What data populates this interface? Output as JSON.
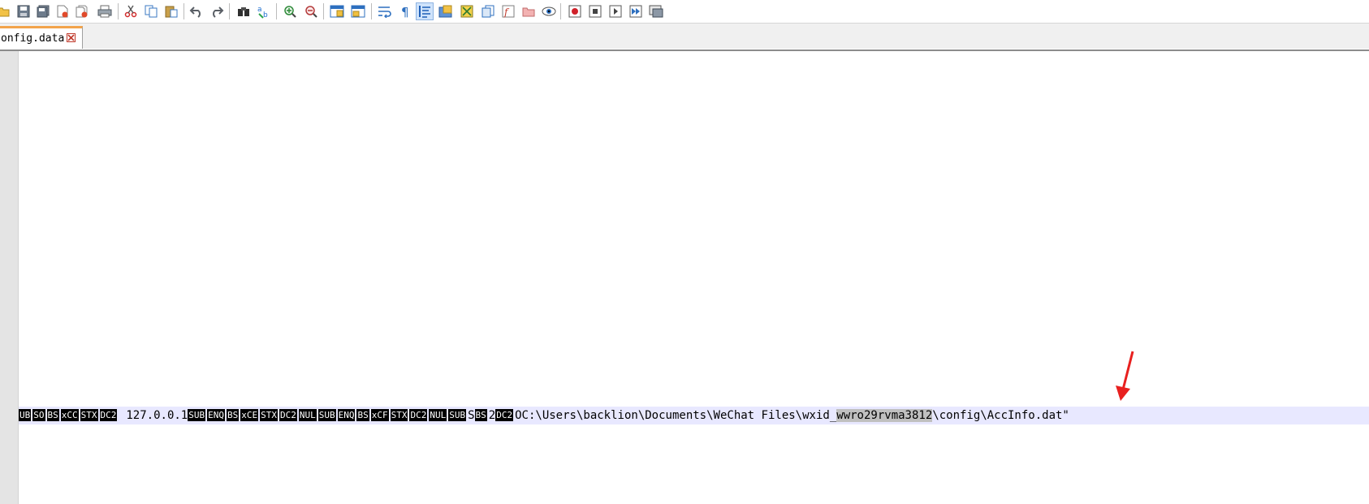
{
  "toolbar": {
    "active_button": "wrap-symbol"
  },
  "tab": {
    "label": "onfig.data"
  },
  "editor": {
    "ctrl_group_1": [
      "UB",
      "SO",
      "BS",
      "xCC",
      "STX",
      "DC2"
    ],
    "text_ip": "127.0.0.1",
    "ctrl_group_2": [
      "SUB",
      "ENQ",
      "BS",
      "xCE",
      "STX",
      "DC2",
      "NUL",
      "SUB",
      "ENQ",
      "BS",
      "xCF",
      "STX",
      "DC2",
      "NUL",
      "SUB"
    ],
    "text_s": "S",
    "ctrl_bs": "BS",
    "text_2": "2",
    "ctrl_dc2": "DC2",
    "path_prefix": "OC:\\Users\\backlion\\Documents\\WeChat Files\\wxid_",
    "selected_text": "wwro29rvma3812",
    "path_suffix": "\\config\\AccInfo.dat\""
  },
  "colors": {
    "arrow": "#e8201f",
    "tab_accent": "#f3a44b",
    "current_line": "#e8e8ff",
    "selection": "#c0c0c0"
  }
}
